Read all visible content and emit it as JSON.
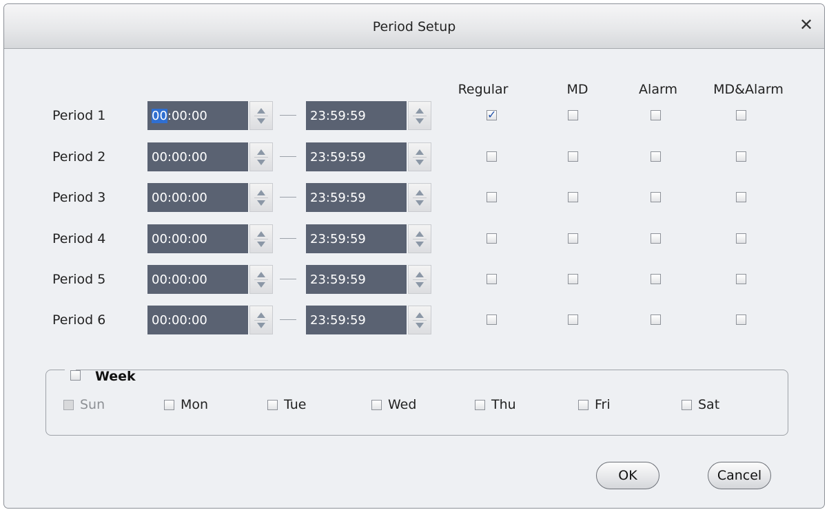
{
  "dialog": {
    "title": "Period Setup",
    "close_symbol": "✕"
  },
  "columns": [
    "Regular",
    "MD",
    "Alarm",
    "MD&Alarm"
  ],
  "periods": [
    {
      "label": "Period 1",
      "start": "00:00:00",
      "end": "23:59:59",
      "checks": [
        true,
        false,
        false,
        false
      ],
      "highlight_hours": true
    },
    {
      "label": "Period 2",
      "start": "00:00:00",
      "end": "23:59:59",
      "checks": [
        false,
        false,
        false,
        false
      ]
    },
    {
      "label": "Period 3",
      "start": "00:00:00",
      "end": "23:59:59",
      "checks": [
        false,
        false,
        false,
        false
      ]
    },
    {
      "label": "Period 4",
      "start": "00:00:00",
      "end": "23:59:59",
      "checks": [
        false,
        false,
        false,
        false
      ]
    },
    {
      "label": "Period 5",
      "start": "00:00:00",
      "end": "23:59:59",
      "checks": [
        false,
        false,
        false,
        false
      ]
    },
    {
      "label": "Period 6",
      "start": "00:00:00",
      "end": "23:59:59",
      "checks": [
        false,
        false,
        false,
        false
      ]
    }
  ],
  "week": {
    "label": "Week",
    "checked": false,
    "days": [
      {
        "label": "Sun",
        "checked": false,
        "disabled": true
      },
      {
        "label": "Mon",
        "checked": false,
        "disabled": false
      },
      {
        "label": "Tue",
        "checked": false,
        "disabled": false
      },
      {
        "label": "Wed",
        "checked": false,
        "disabled": false
      },
      {
        "label": "Thu",
        "checked": false,
        "disabled": false
      },
      {
        "label": "Fri",
        "checked": false,
        "disabled": false
      },
      {
        "label": "Sat",
        "checked": false,
        "disabled": false
      }
    ]
  },
  "buttons": {
    "ok": "OK",
    "cancel": "Cancel"
  },
  "colors": {
    "time_field_bg": "#5a6272",
    "selection": "#2f6fd1",
    "dialog_bg": "#eef0f3"
  }
}
